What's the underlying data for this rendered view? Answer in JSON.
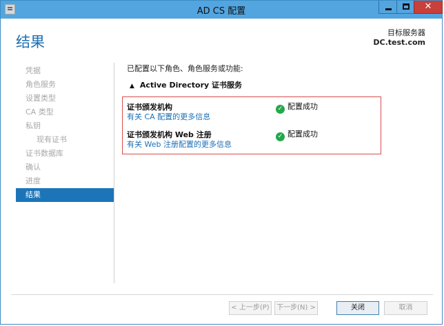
{
  "window": {
    "title": "AD CS 配置",
    "close_glyph": "✕"
  },
  "header": {
    "page_title": "结果",
    "target_label": "目标服务器",
    "target_value": "DC.test.com"
  },
  "nav": {
    "items": [
      {
        "label": "凭据",
        "state": "disabled"
      },
      {
        "label": "角色服务",
        "state": "disabled"
      },
      {
        "label": "设置类型",
        "state": "disabled"
      },
      {
        "label": "CA 类型",
        "state": "disabled"
      },
      {
        "label": "私钥",
        "state": "disabled"
      },
      {
        "label": "现有证书",
        "state": "disabled"
      },
      {
        "label": "证书数据库",
        "state": "disabled"
      },
      {
        "label": "确认",
        "state": "disabled"
      },
      {
        "label": "进度",
        "state": "disabled"
      },
      {
        "label": "结果",
        "state": "active"
      }
    ]
  },
  "main": {
    "intro": "已配置以下角色、角色服务或功能:",
    "section_chevron": "▲",
    "section_title": "Active Directory 证书服务",
    "results": [
      {
        "name": "证书颁发机构",
        "status": "配置成功",
        "link": "有关 CA 配置的更多信息"
      },
      {
        "name": "证书颁发机构 Web 注册",
        "status": "配置成功",
        "link": "有关 Web 注册配置的更多信息"
      }
    ],
    "status_icon": "check-circle-icon",
    "success_color": "#23a84b"
  },
  "footer": {
    "prev": "< 上一步(P)",
    "next": "下一步(N) >",
    "close": "关闭",
    "cancel": "取消"
  }
}
